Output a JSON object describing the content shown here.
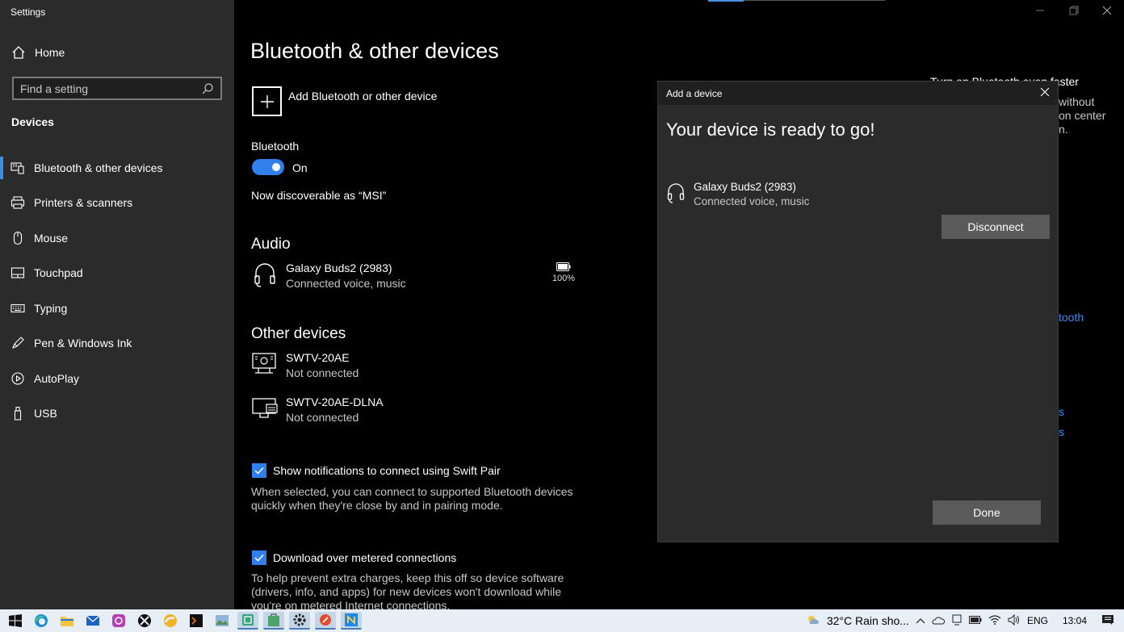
{
  "window": {
    "title": "Settings"
  },
  "sidebar": {
    "home_label": "Home",
    "search_placeholder": "Find a setting",
    "section_title": "Devices",
    "items": [
      {
        "label": "Bluetooth & other devices",
        "icon": "bluetooth-devices-icon",
        "active": true
      },
      {
        "label": "Printers & scanners",
        "icon": "printer-icon"
      },
      {
        "label": "Mouse",
        "icon": "mouse-icon"
      },
      {
        "label": "Touchpad",
        "icon": "touchpad-icon"
      },
      {
        "label": "Typing",
        "icon": "keyboard-icon"
      },
      {
        "label": "Pen & Windows Ink",
        "icon": "pen-icon"
      },
      {
        "label": "AutoPlay",
        "icon": "autoplay-icon"
      },
      {
        "label": "USB",
        "icon": "usb-icon"
      }
    ]
  },
  "main": {
    "title": "Bluetooth & other devices",
    "add_device_label": "Add Bluetooth or other device",
    "bluetooth_label": "Bluetooth",
    "bluetooth_state": "On",
    "discoverable_text": "Now discoverable as “MSI”",
    "audio_heading": "Audio",
    "audio_devices": [
      {
        "name": "Galaxy Buds2 (2983)",
        "status": "Connected voice, music",
        "battery": "100%"
      }
    ],
    "other_heading": "Other devices",
    "other_devices": [
      {
        "name": "SWTV-20AE",
        "status": "Not connected"
      },
      {
        "name": "SWTV-20AE-DLNA",
        "status": "Not connected"
      }
    ],
    "swift_pair_label": "Show notifications to connect using Swift Pair",
    "swift_pair_desc": "When selected, you can connect to supported Bluetooth devices quickly when they're close by and in pairing mode.",
    "metered_label": "Download over metered connections",
    "metered_desc": "To help prevent extra charges, keep this off so device software (drivers, info, and apps) for new devices won't download while you're on metered Internet connections.",
    "right_fragments": {
      "line1": "Turn on Bluetooth even faster",
      "line2": "without",
      "line3": "on center",
      "line4": "n.",
      "link1": "tooth",
      "link2": "s",
      "link3": "s"
    }
  },
  "dialog": {
    "title": "Add a device",
    "heading": "Your device is ready to go!",
    "device_name": "Galaxy Buds2 (2983)",
    "device_status": "Connected voice, music",
    "disconnect_label": "Disconnect",
    "done_label": "Done"
  },
  "taskbar": {
    "apps": [
      "start-icon",
      "edge-icon",
      "file-explorer-icon",
      "mail-icon",
      "instagram-icon",
      "xbox-icon",
      "edge-legacy-icon",
      "terminal-icon",
      "photos-icon",
      "snip-icon",
      "store-icon",
      "settings-icon",
      "ink-icon",
      "notepad-icon"
    ],
    "weather": "32°C  Rain sho...",
    "language": "ENG",
    "time": "13:04"
  },
  "colors": {
    "accent": "#2f80ed",
    "sidebar": "#2b2b2b",
    "dialog": "#2b2b2b",
    "taskbar": "#e8eef5"
  }
}
